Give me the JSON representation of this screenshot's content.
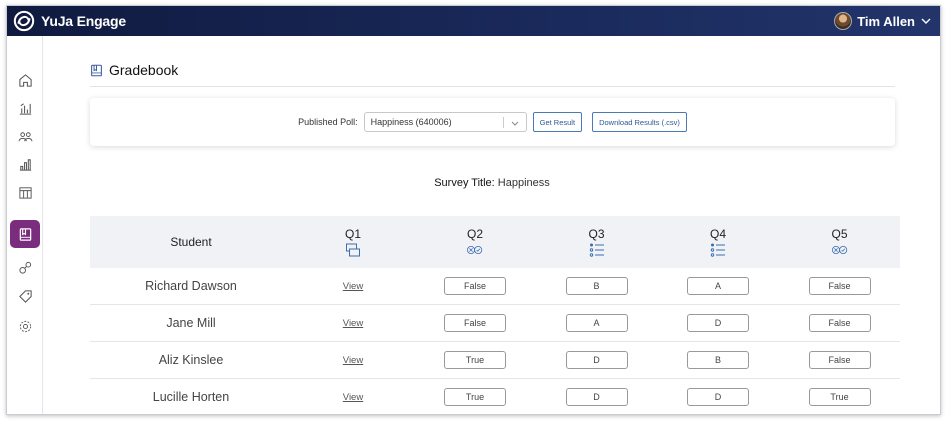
{
  "app": {
    "name": "YuJa Engage"
  },
  "user": {
    "name": "Tim Allen"
  },
  "sidebar": {
    "items": [
      {
        "icon": "home-icon",
        "active": false
      },
      {
        "icon": "analytics-icon",
        "active": false
      },
      {
        "icon": "users-icon",
        "active": false
      },
      {
        "icon": "bar-chart-icon",
        "active": false
      },
      {
        "icon": "calendar-grid-icon",
        "active": false
      },
      {
        "icon": "gradebook-icon",
        "active": true
      },
      {
        "icon": "integrations-icon",
        "active": false
      },
      {
        "icon": "tag-icon",
        "active": false
      },
      {
        "icon": "settings-icon",
        "active": false
      }
    ]
  },
  "page": {
    "title": "Gradebook"
  },
  "poll": {
    "label": "Published Poll:",
    "selected": "Happiness (640006)",
    "get_result": "Get Result",
    "download": "Download Results (.csv)"
  },
  "survey": {
    "label": "Survey Title:",
    "value": "Happiness"
  },
  "table": {
    "headers": {
      "student": "Student",
      "q1": "Q1",
      "q2": "Q2",
      "q3": "Q3",
      "q4": "Q4",
      "q5": "Q5"
    },
    "view_label": "View",
    "rows": [
      {
        "student": "Richard Dawson",
        "q2": "False",
        "q3": "B",
        "q4": "A",
        "q5": "False"
      },
      {
        "student": "Jane Mill",
        "q2": "False",
        "q3": "A",
        "q4": "D",
        "q5": "False"
      },
      {
        "student": "Aliz Kinslee",
        "q2": "True",
        "q3": "D",
        "q4": "B",
        "q5": "False"
      },
      {
        "student": "Lucille Horten",
        "q2": "True",
        "q3": "D",
        "q4": "D",
        "q5": "True"
      }
    ]
  },
  "colors": {
    "header_bg": "#101a3f",
    "accent": "#7a2c7d",
    "link": "#2a5a99"
  }
}
